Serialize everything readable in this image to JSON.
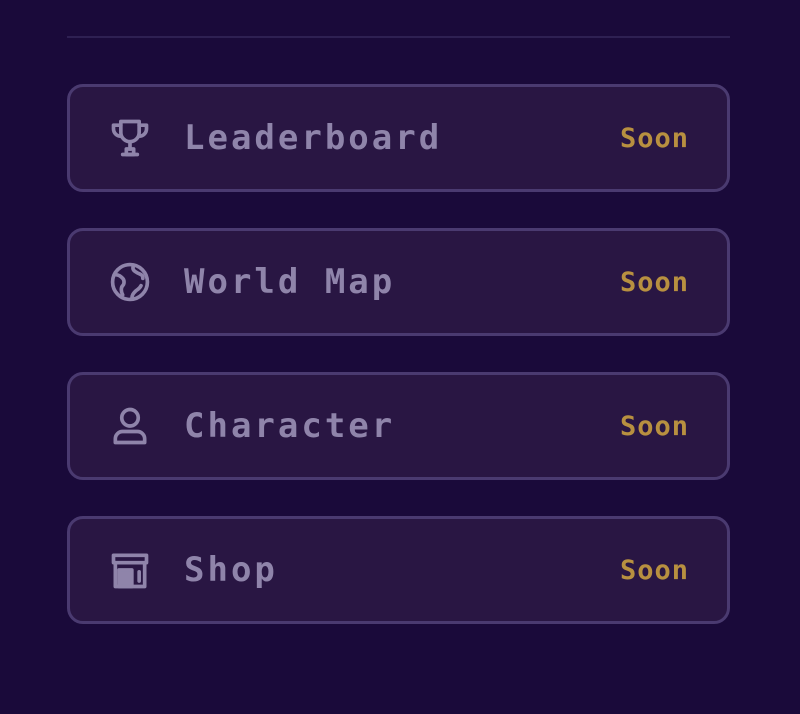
{
  "menu": {
    "items": [
      {
        "label": "Leaderboard",
        "badge": "Soon",
        "icon": "trophy-icon"
      },
      {
        "label": "World Map",
        "badge": "Soon",
        "icon": "globe-icon"
      },
      {
        "label": "Character",
        "badge": "Soon",
        "icon": "user-icon"
      },
      {
        "label": "Shop",
        "badge": "Soon",
        "icon": "store-icon"
      }
    ]
  },
  "colors": {
    "background": "#1a0a3a",
    "card": "#291643",
    "border": "#4a3a70",
    "label": "#8f84aa",
    "badge": "#b89040"
  }
}
